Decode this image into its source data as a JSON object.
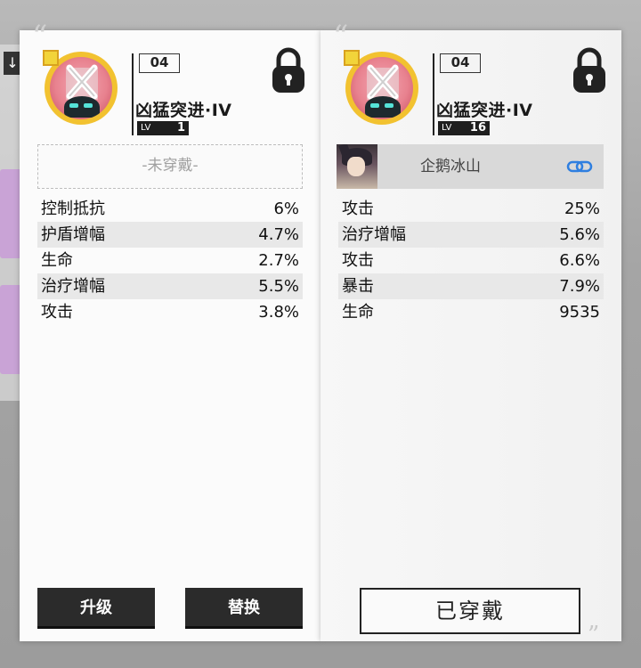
{
  "cards": [
    {
      "id": "left",
      "number": "04",
      "name": "凶猛突进·IV",
      "lv_label": "LV",
      "level": "1",
      "equip_slot_text": "-未穿戴-",
      "stats": [
        {
          "name": "控制抵抗",
          "value": "6%"
        },
        {
          "name": "护盾增幅",
          "value": "4.7%"
        },
        {
          "name": "生命",
          "value": "2.7%"
        },
        {
          "name": "治疗增幅",
          "value": "5.5%"
        },
        {
          "name": "攻击",
          "value": "3.8%"
        }
      ],
      "buttons": {
        "upgrade": "升级",
        "replace": "替换"
      }
    },
    {
      "id": "right",
      "number": "04",
      "name": "凶猛突进·IV",
      "lv_label": "LV",
      "level": "16",
      "equipped_character": "企鹅冰山",
      "stats": [
        {
          "name": "攻击",
          "value": "25%"
        },
        {
          "name": "治疗增幅",
          "value": "5.6%"
        },
        {
          "name": "攻击",
          "value": "6.6%"
        },
        {
          "name": "暴击",
          "value": "7.9%"
        },
        {
          "name": "生命",
          "value": "9535"
        }
      ],
      "buttons": {
        "equipped": "已穿戴"
      }
    }
  ],
  "icons": {
    "lock": "lock-icon",
    "link": "link-icon",
    "gem": "memory-chip-icon"
  },
  "colors": {
    "gem_frame": "#f2c230",
    "link_blue": "#2f7fe0",
    "button_dark": "#2b2b2b"
  }
}
